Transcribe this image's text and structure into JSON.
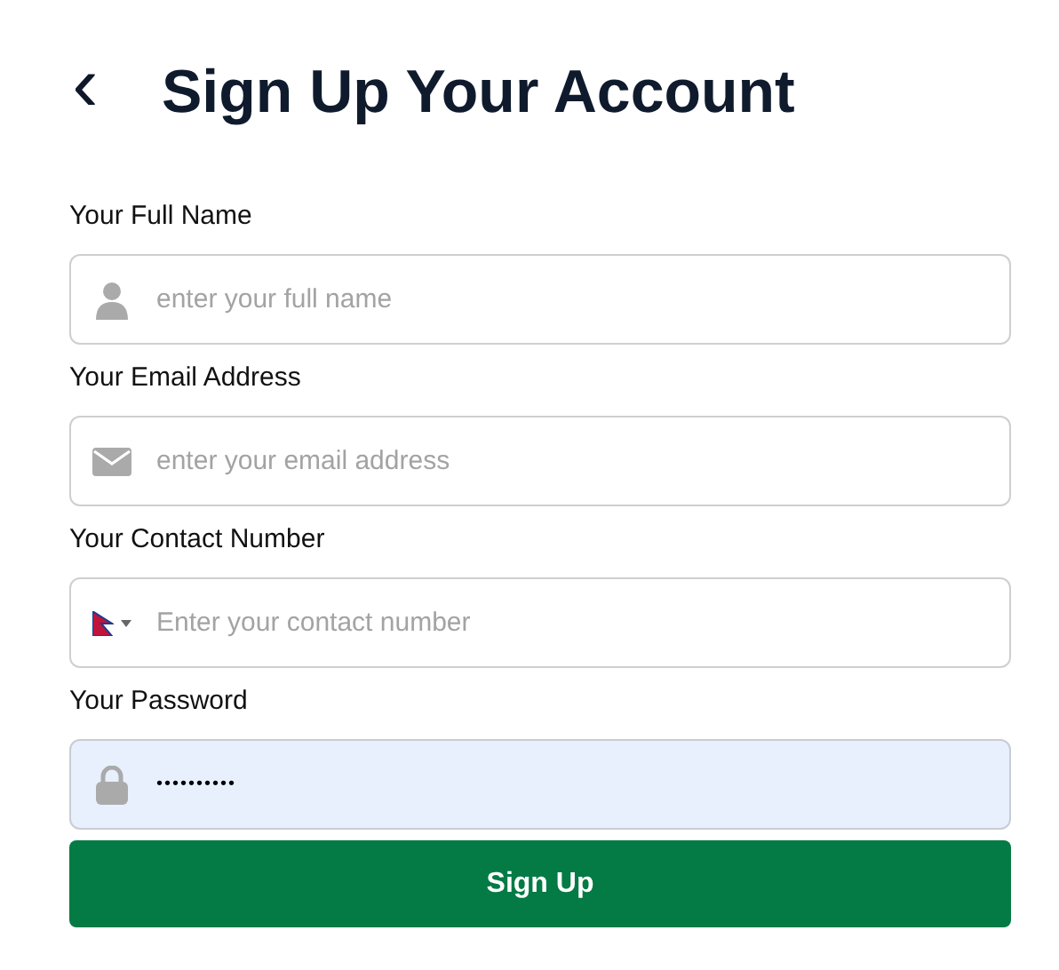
{
  "header": {
    "back": "‹",
    "title": "Sign Up Your Account"
  },
  "fields": [
    {
      "kind": "name",
      "label": "Your Full Name",
      "placeholder": "enter your full name",
      "autofilled": false
    },
    {
      "kind": "email",
      "label": "Your Email Address",
      "placeholder": "enter your email address",
      "autofilled": false
    },
    {
      "kind": "phone",
      "label": "Your Contact Number",
      "placeholder": "Enter your contact number",
      "autofilled": false
    },
    {
      "kind": "password",
      "label": "Your Password",
      "value": "••••••••••",
      "autofilled": true
    }
  ],
  "submit": "Sign Up"
}
